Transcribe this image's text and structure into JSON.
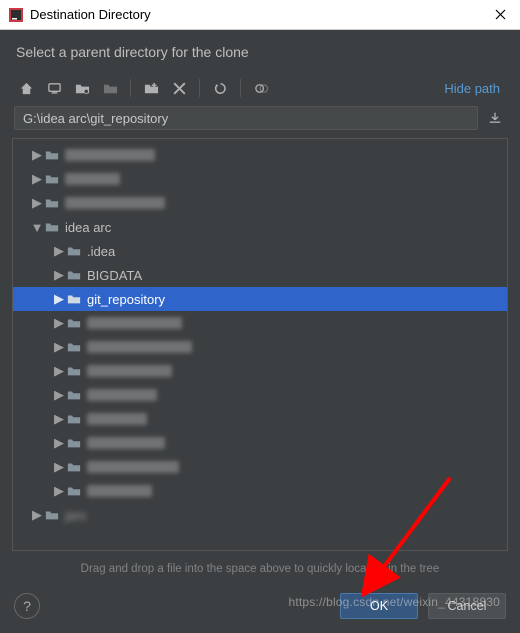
{
  "titlebar": {
    "title": "Destination Directory"
  },
  "instruction": "Select a parent directory for the clone",
  "toolbar": {
    "hide_path": "Hide path"
  },
  "path": {
    "value": "G:\\idea arc\\git_repository"
  },
  "tree": {
    "idea_arc": {
      "label": "idea arc"
    },
    "idea": {
      "label": ".idea"
    },
    "bigdata": {
      "label": "BIGDATA"
    },
    "git_repo": {
      "label": "git_repository"
    },
    "jars": {
      "label": "jars"
    }
  },
  "hint": "Drag and drop a file into the space above to quickly locate it in the tree",
  "buttons": {
    "ok": "OK",
    "cancel": "Cancel",
    "help": "?"
  },
  "watermark": "https://blog.csdn.net/weixin_44318830"
}
